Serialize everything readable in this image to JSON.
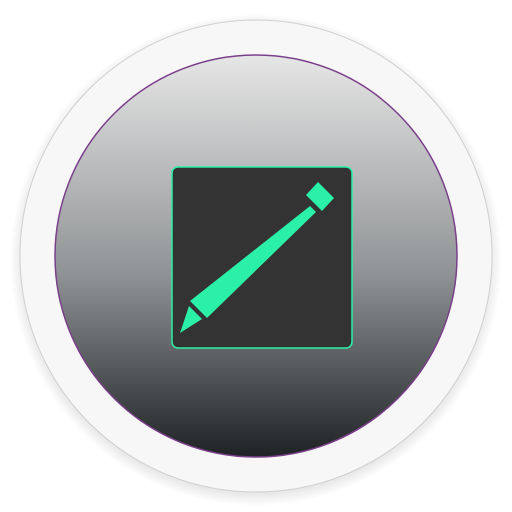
{
  "app_icon": {
    "icon_name": "pencil-edit-icon",
    "colors": {
      "background": "#ffffff",
      "outer_ring": "#f7f7f7",
      "outer_ring_shadow": "#cfcfcf",
      "disc_top": "#e6e6e6",
      "disc_bottom": "#1f2224",
      "disc_edge": "#7a3f8a",
      "tile_fill": "#333333",
      "tile_border": "#2bf0a8",
      "pencil": "#2bf0a8"
    }
  }
}
